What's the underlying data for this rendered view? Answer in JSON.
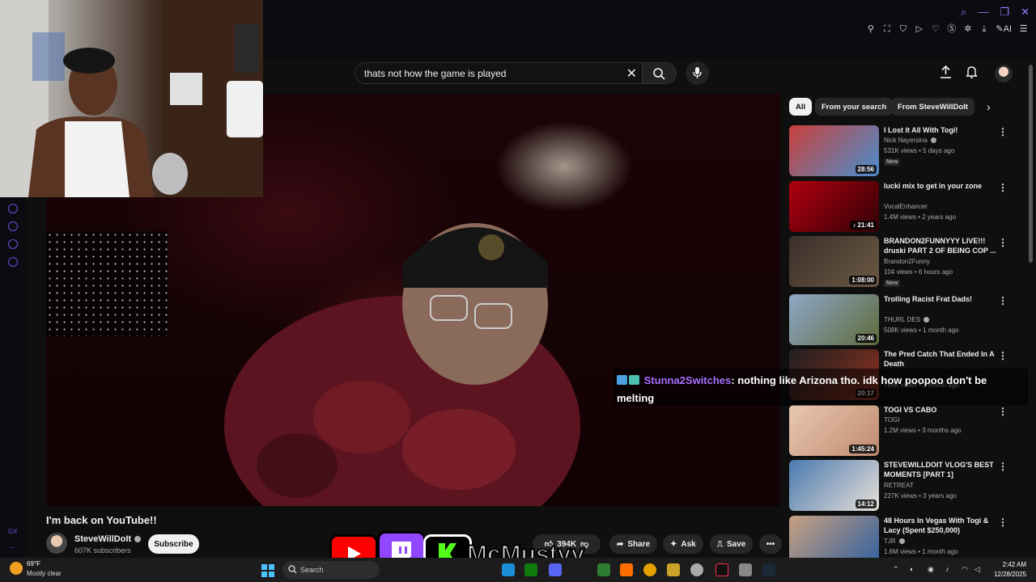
{
  "browser": {
    "window_controls": [
      "search-icon",
      "minimize-icon",
      "maximize-icon",
      "close-icon"
    ],
    "extensions": [
      "pin",
      "snapshot",
      "shield",
      "play",
      "heart",
      "s",
      "puzzle",
      "download",
      "ai",
      "menu"
    ],
    "ai_label": "AI"
  },
  "sidebar": {
    "icons": [
      "player-icon",
      "history-icon",
      "extensions-icon",
      "settings-icon"
    ],
    "gx_label": "GX",
    "more_label": "..."
  },
  "header": {
    "search_query": "thats not how the game is played"
  },
  "video": {
    "title": "I'm back on YouTube!!",
    "channel": "SteveWillDoIt",
    "subscribers": "607K subscribers",
    "subscribe_label": "Subscribe",
    "likes": "394K",
    "share_label": "Share",
    "ask_label": "Ask",
    "save_label": "Save"
  },
  "chips": [
    {
      "label": "All",
      "active": true
    },
    {
      "label": "From your search",
      "active": false
    },
    {
      "label": "From SteveWillDoIt",
      "active": false
    }
  ],
  "recommendations": [
    {
      "title": "I Lost It All With Togi!",
      "channel": "Nick Nayersina",
      "verified": true,
      "meta": "531K views • 5 days ago",
      "badge": "New",
      "duration": "28:56",
      "colors": [
        "#c9403a",
        "#4a8fd0"
      ]
    },
    {
      "title": "lucki mix to get in your zone",
      "channel": "VocalEnhancer",
      "verified": false,
      "meta": "1.4M views • 2 years ago",
      "badge": "",
      "duration": "♪ 21:41",
      "colors": [
        "#b00010",
        "#300005"
      ]
    },
    {
      "title": "BRANDON2FUNNYYY LIVE!!! druski PART 2 OF BEING COP ...",
      "channel": "Brandon2Funny",
      "verified": false,
      "meta": "104 views • 6 hours ago",
      "badge": "New",
      "duration": "1:08:00",
      "colors": [
        "#3a2e2a",
        "#6c5a44"
      ]
    },
    {
      "title": "Trolling Racist Frat Dads!",
      "channel": "THURL DES",
      "verified": true,
      "meta": "508K views • 1 month ago",
      "badge": "",
      "duration": "20:46",
      "colors": [
        "#8fa8c8",
        "#5d6a3a"
      ]
    },
    {
      "title": "The Pred Catch That Ended In A Death",
      "channel": "",
      "verified": false,
      "meta": "766K views • 1 month ago",
      "badge": "",
      "duration": "20:17",
      "colors": [
        "#202020",
        "#903020"
      ]
    },
    {
      "title": "TOGI VS CABO",
      "channel": "TOGI",
      "verified": false,
      "meta": "1.2M views • 3 months ago",
      "badge": "",
      "duration": "1:45:24",
      "colors": [
        "#e8c8b0",
        "#c08a70"
      ]
    },
    {
      "title": "STEVEWILLDOIT VLOG'S BEST MOMENTS [PART 1]",
      "channel": "RETREAT",
      "verified": false,
      "meta": "227K views • 3 years ago",
      "badge": "",
      "duration": "14:12",
      "colors": [
        "#4a7ab0",
        "#e8e0d8"
      ]
    },
    {
      "title": "48 Hours In Vegas With Togi & Lacy (Spent $250,000)",
      "channel": "TJR",
      "verified": true,
      "meta": "1.6M views • 1 month ago",
      "badge": "",
      "duration": "",
      "colors": [
        "#c8a080",
        "#3060a0"
      ]
    }
  ],
  "chat": {
    "username": "Stunna2Switches",
    "message": ": nothing like Arizona tho. idk how poopoo don't be melting"
  },
  "overlay": {
    "streamer_name": "McMustyy"
  },
  "taskbar": {
    "temperature": "69°F",
    "condition": "Mostly clear",
    "search_label": "Search",
    "time": "2:42 AM",
    "date": "12/28/2025",
    "weather_badge": "2"
  },
  "colors": {
    "accent": "#a970ff",
    "yt_red": "#ff0000",
    "twitch_purple": "#9146ff",
    "kick_green": "#53fc18"
  }
}
